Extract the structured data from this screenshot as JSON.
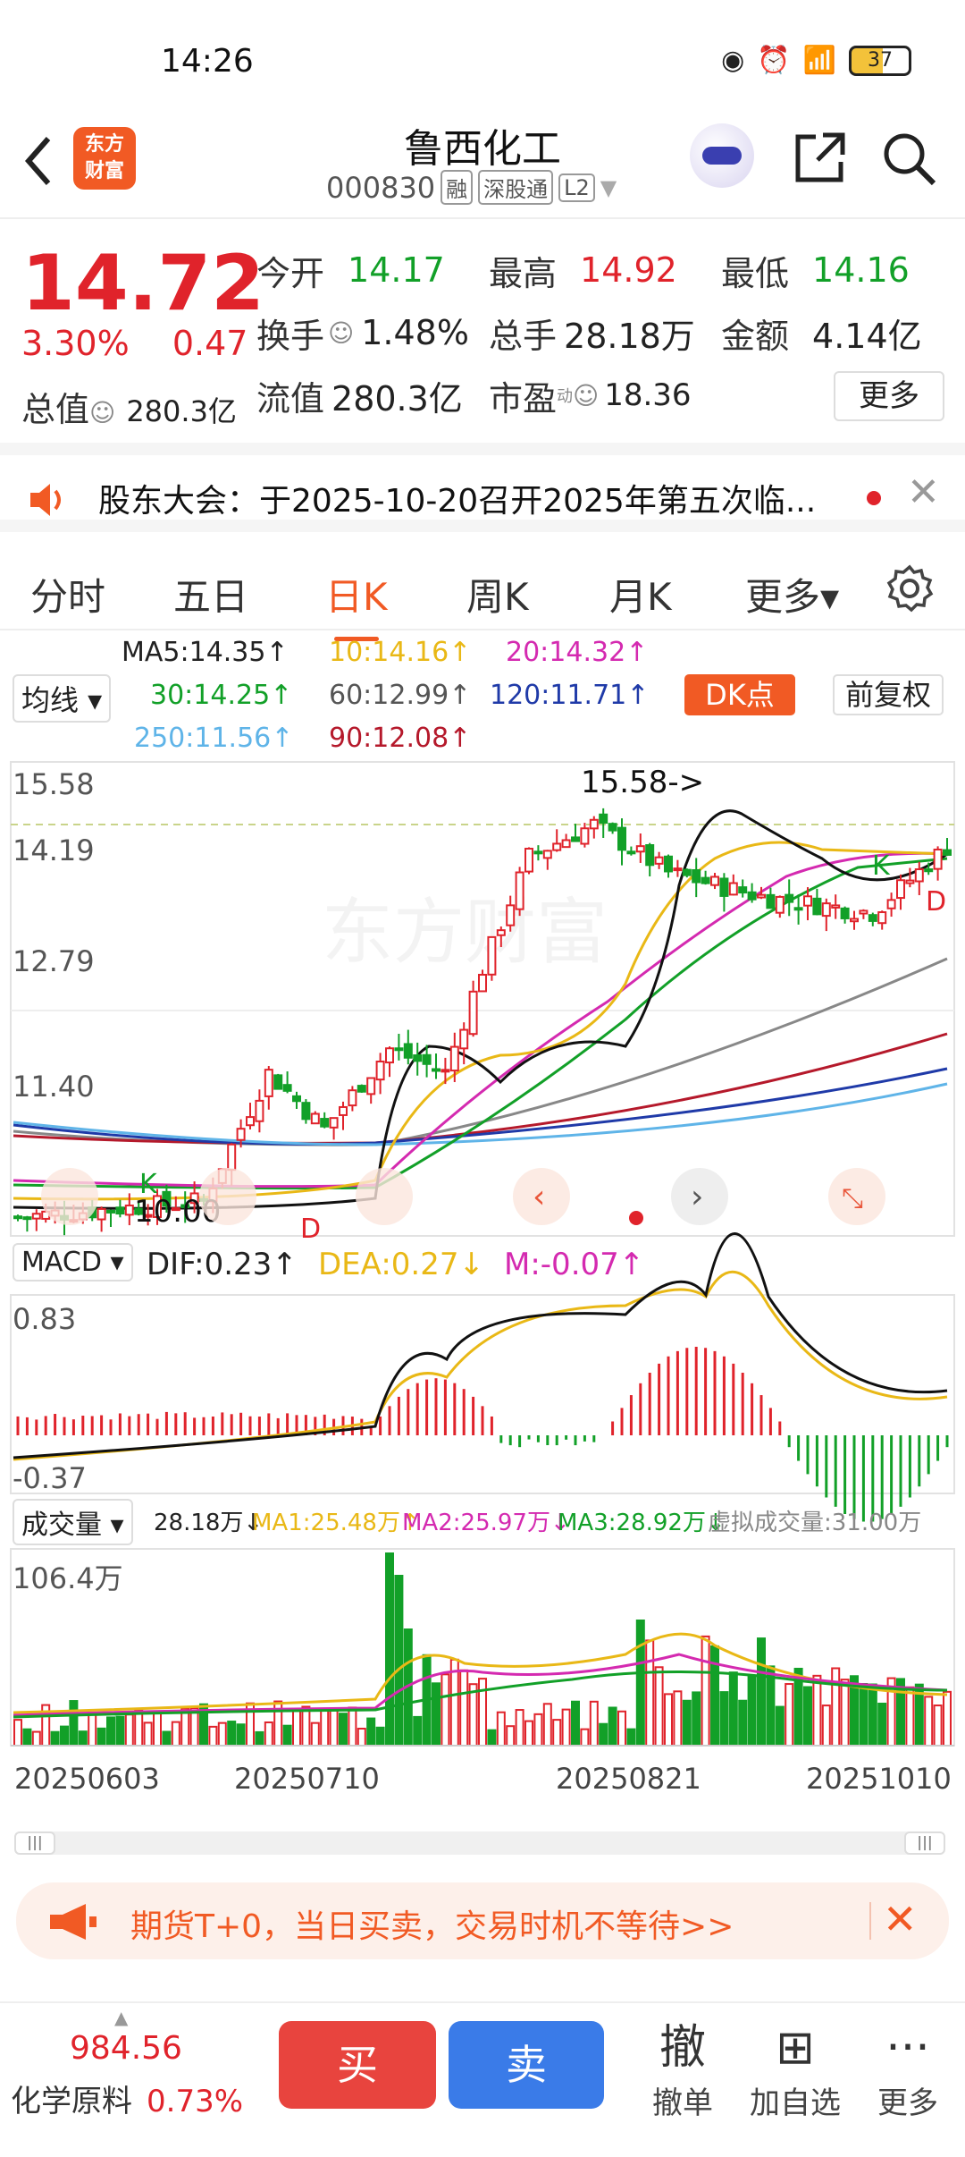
{
  "status": {
    "time": "14:26",
    "battery": "37"
  },
  "header": {
    "name": "鲁西化工",
    "code": "000830",
    "tags": [
      "融",
      "深股通",
      "L2"
    ],
    "logo_text": "东方\n财富"
  },
  "quote": {
    "price": "14.72",
    "pct": "3.30%",
    "chg": "0.47",
    "open_label": "今开",
    "open": "14.17",
    "high_label": "最高",
    "high": "14.92",
    "low_label": "最低",
    "low": "14.16",
    "turnover_label": "换手",
    "turnover": "1.48%",
    "vol_label": "总手",
    "vol": "28.18万",
    "amount_label": "金额",
    "amount": "4.14亿",
    "mcap_label": "总值",
    "mcap": "280.3亿",
    "float_label": "流值",
    "float": "280.3亿",
    "pe_label": "市盈",
    "pe_sup": "动",
    "pe": "18.36",
    "more": "更多"
  },
  "notice": {
    "text": "股东大会：于2025-10-20召开2025年第五次临..."
  },
  "tabs": [
    "分时",
    "五日",
    "日K",
    "周K",
    "月K",
    "更多▾"
  ],
  "ma": {
    "ma5": "MA5:14.35↑",
    "ma10": "10:14.16↑",
    "ma20": "20:14.32↑",
    "ma30": "30:14.25↑",
    "ma60": "60:12.99↑",
    "ma120": "120:11.71↑",
    "ma250": "250:11.56↑",
    "ma90": "90:12.08↑",
    "select": "均线 ▾",
    "dk": "DK点",
    "fq": "前复权"
  },
  "price_axis": {
    "top": "15.58",
    "a": "14.19",
    "b": "12.79",
    "c": "11.40",
    "bottom": "10.00",
    "annot": "15.58->",
    "low_annot": "10.00"
  },
  "macd": {
    "select": "MACD ▾",
    "dif": "DIF:0.23↑",
    "dea": "DEA:0.27↓",
    "m": "M:-0.07↑",
    "top": "0.83",
    "bottom": "-0.37"
  },
  "volume": {
    "select": "成交量 ▾",
    "v": "28.18万↓",
    "ma1": "MA1:25.48万↑",
    "ma2": "MA2:25.97万↓",
    "ma3": "MA3:28.92万↓",
    "virtual": "虚拟成交量:31.00万",
    "top": "106.4万"
  },
  "dates": [
    "20250603",
    "20250710",
    "20250821",
    "20251010"
  ],
  "ad": {
    "text": "期货T+0，当日买卖，交易时机不等待>>"
  },
  "bottom": {
    "index": "984.56",
    "index_name": "化学原料",
    "index_pct": "0.73%",
    "buy": "买",
    "sell": "卖",
    "cancel": "撤单",
    "add": "加自选",
    "more": "更多"
  },
  "colors": {
    "up": "#e0232b",
    "down": "#12a028",
    "accent": "#f15a24"
  },
  "chart_data": {
    "type": "candlestick",
    "ylim": [
      10.0,
      15.58
    ],
    "close_points": [
      [
        0,
        10.1
      ],
      [
        10,
        10.2
      ],
      [
        20,
        10.3
      ],
      [
        27,
        11.9
      ],
      [
        33,
        11.2
      ],
      [
        40,
        12.2
      ],
      [
        46,
        11.9
      ],
      [
        50,
        13.2
      ],
      [
        55,
        14.6
      ],
      [
        62,
        15.0
      ],
      [
        70,
        14.4
      ],
      [
        80,
        14.1
      ],
      [
        92,
        13.9
      ],
      [
        100,
        14.72
      ]
    ]
  }
}
